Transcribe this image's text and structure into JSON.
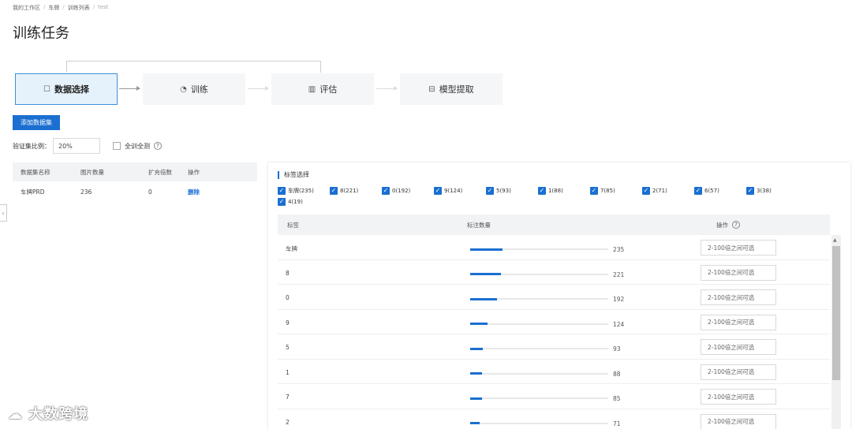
{
  "breadcrumb": [
    "我的工作区",
    "车牌",
    "训练列表",
    "test"
  ],
  "page_title": "训练任务",
  "steps": [
    {
      "label": "数据选择",
      "icon": "data-select-icon",
      "glyph": "☐"
    },
    {
      "label": "训练",
      "icon": "train-icon",
      "glyph": "◔"
    },
    {
      "label": "评估",
      "icon": "chart-icon",
      "glyph": "▥"
    },
    {
      "label": "模型提取",
      "icon": "extract-icon",
      "glyph": "⊟"
    }
  ],
  "add_dataset_button": "添加数据集",
  "validation": {
    "label": "验证集比例：",
    "value": "20%",
    "full_train_label": "全训全测"
  },
  "dataset_table": {
    "headers": [
      "数据集名称",
      "图片数量",
      "扩充倍数",
      "操作"
    ],
    "rows": [
      {
        "name": "车牌PRD",
        "count": "236",
        "multiplier": "0",
        "action": "删除"
      }
    ]
  },
  "label_panel": {
    "title": "标签选择",
    "tags": [
      "车牌(235)",
      "8(221)",
      "0(192)",
      "9(124)",
      "5(93)",
      "1(88)",
      "7(85)",
      "2(71)",
      "6(57)",
      "3(38)",
      "4(19)"
    ],
    "headers": [
      "标签",
      "标注数量",
      "操作"
    ],
    "placeholder": "2-100倍之间可选",
    "max_count": 235,
    "rows": [
      {
        "label": "车牌",
        "count": 235
      },
      {
        "label": "8",
        "count": 221
      },
      {
        "label": "0",
        "count": 192
      },
      {
        "label": "9",
        "count": 124
      },
      {
        "label": "5",
        "count": 93
      },
      {
        "label": "1",
        "count": 88
      },
      {
        "label": "7",
        "count": 85
      },
      {
        "label": "2",
        "count": 71
      }
    ]
  },
  "watermark": "大数跨境",
  "colors": {
    "accent": "#1a6fd1",
    "active_step_bg": "#e6f2fb"
  }
}
